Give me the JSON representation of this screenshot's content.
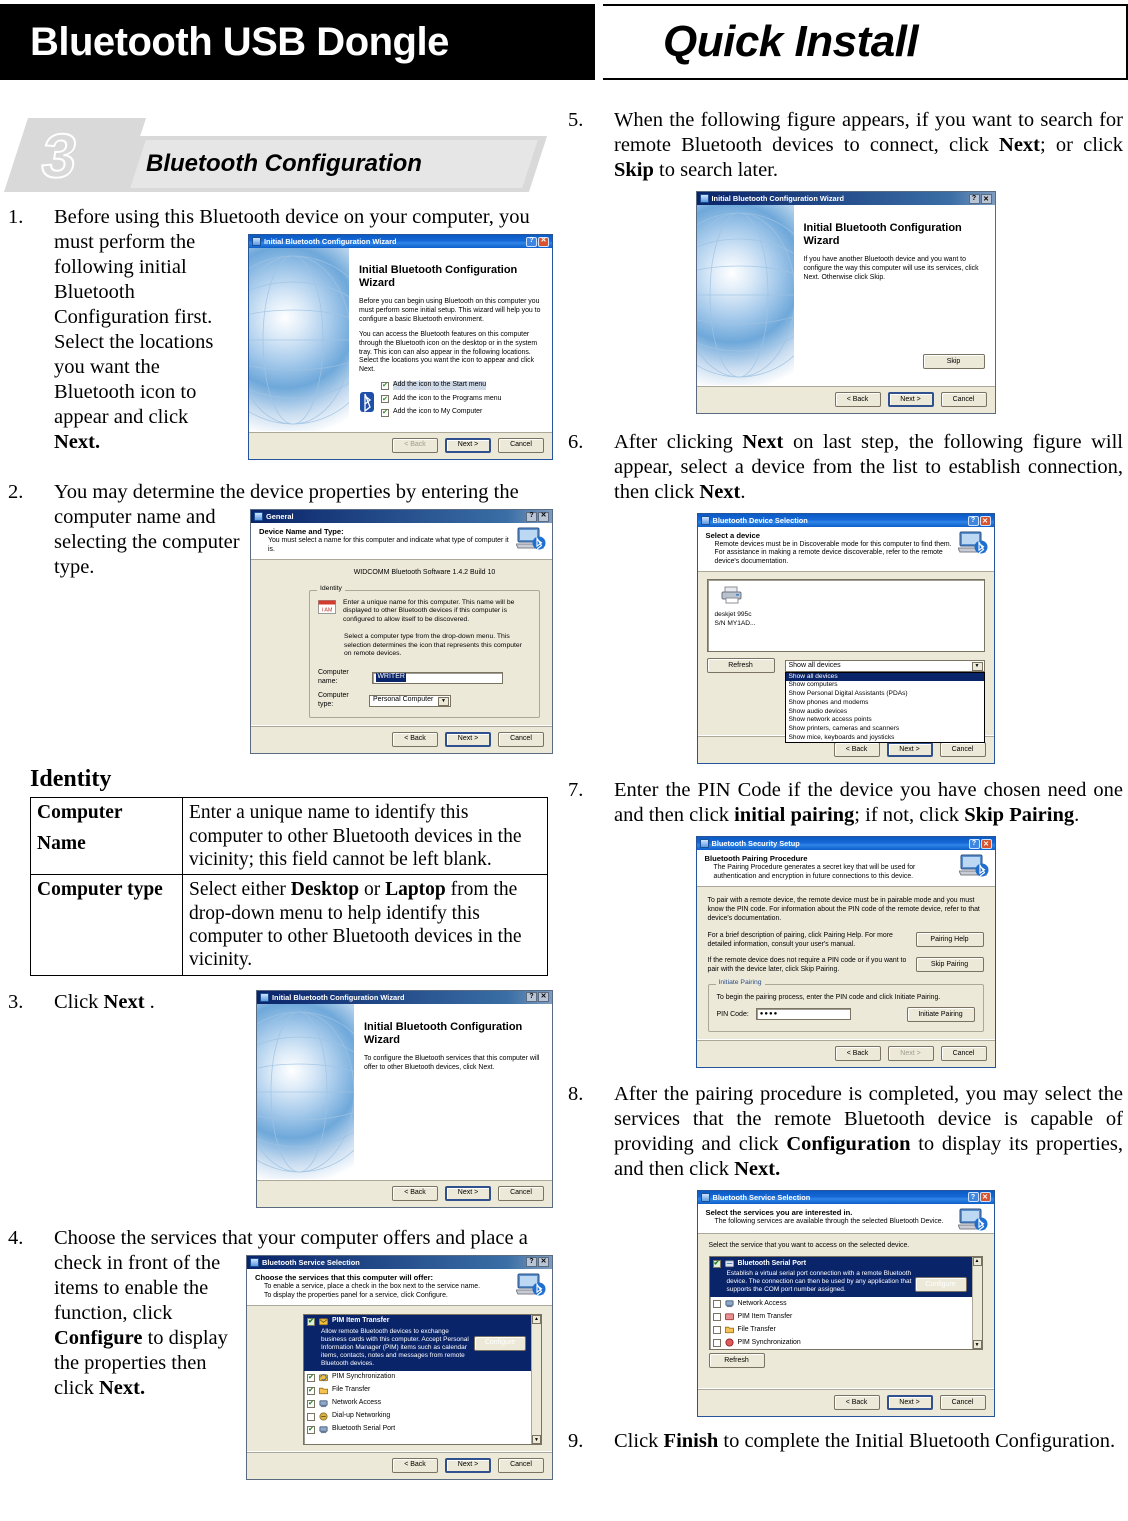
{
  "header": {
    "product_title": "Bluetooth USB Dongle",
    "doc_title": "Quick Install"
  },
  "section": {
    "number": "3",
    "title": "Bluetooth Configuration"
  },
  "identity_table": {
    "title": "Identity",
    "rows": [
      {
        "key": "Computer",
        "key2": "Name",
        "value_parts": [
          {
            "t": "Enter a unique name to identify this computer to other Bluetooth devices in the vicinity; this field cannot be left blank.",
            "b": false
          }
        ]
      },
      {
        "key": "Computer type",
        "key2": "",
        "value_parts": [
          {
            "t": "Select either ",
            "b": false
          },
          {
            "t": "Desktop",
            "b": true
          },
          {
            "t": " or ",
            "b": false
          },
          {
            "t": "Laptop",
            "b": true
          },
          {
            "t": " from the drop-down menu to help identify this computer to other Bluetooth devices in the vicinity.",
            "b": false
          }
        ]
      }
    ]
  },
  "steps": {
    "s1": {
      "num": "1.",
      "lead": "Before using this Bluetooth device on your computer, you",
      "rest_a": "must perform the following initial Bluetooth Configuration first. Select the locations you want the Bluetooth icon to appear and click ",
      "rest_b": "Next."
    },
    "s2": {
      "num": "2.",
      "lead": "You may determine the device properties by entering the",
      "rest": "computer name and selecting the computer type."
    },
    "s3": {
      "num": "3.",
      "a": "Click ",
      "b": "Next",
      "c": " ."
    },
    "s4": {
      "num": "4.",
      "lead": "Choose the services that your computer offers and place a",
      "a": "check in front of the items to enable the function, click ",
      "b": "Configure",
      "c": " to display the properties then click ",
      "d": "Next."
    },
    "s5": {
      "num": "5.",
      "a": "When the following figure appears, if you want to search for remote Bluetooth devices to connect, click ",
      "b": "Next",
      "c": "; or click ",
      "d": "Skip",
      "e": " to search later."
    },
    "s6": {
      "num": "6.",
      "a": "After clicking ",
      "b": "Next",
      "c": " on last step, the following figure will appear, select a device from the list to establish connection, then click ",
      "d": "Next",
      "e": "."
    },
    "s7": {
      "num": "7.",
      "a": "Enter the PIN Code if the device you have chosen need one and then click ",
      "b": "initial pairing",
      "c": "; if not, click ",
      "d": "Skip Pairing",
      "e": "."
    },
    "s8": {
      "num": "8.",
      "a": "After the pairing procedure is completed, you may select the services that the remote Bluetooth device is capable of providing and click ",
      "b": "Configuration",
      "c": " to display its properties, and then click ",
      "d": "Next."
    },
    "s9": {
      "num": "9.",
      "a": "Click ",
      "b": "Finish",
      "c": " to complete the Initial Bluetooth Configuration."
    }
  },
  "dialogs": {
    "wizard1": {
      "title": "Initial Bluetooth Configuration Wizard",
      "heading": "Initial Bluetooth Configuration Wizard",
      "p1": "Before you can begin using Bluetooth on this computer you must perform some initial setup. This wizard will help you to configure a basic Bluetooth environment.",
      "p2": "You can access the Bluetooth features on this computer through the Bluetooth icon on the desktop or in the system tray. This icon can also appear in the following locations. Select the locations you want the icon to appear and click Next.",
      "checks": [
        "Add the icon to the Start menu",
        "Add the icon to the Programs menu",
        "Add the icon to My Computer"
      ],
      "buttons": {
        "back": "< Back",
        "next": "Next >",
        "cancel": "Cancel"
      }
    },
    "general": {
      "title": "General",
      "hdr_title": "Device Name and Type:",
      "hdr_sub": "You must select a name for this computer and indicate what type of computer it is.",
      "version": "WIDCOMM Bluetooth Software 1.4.2 Build 10",
      "group_label": "Identity",
      "p1": "Enter a unique name for this computer.  This name will be displayed to other Bluetooth devices if this computer is configured to allow itself to be discovered.",
      "p2": "Select a computer type from the drop-down menu.  This selection determines the icon that represents this computer on remote devices.",
      "name_label": "Computer name:",
      "name_value": "WRITER",
      "type_label": "Computer type:",
      "type_value": "Personal Computer",
      "buttons": {
        "back": "< Back",
        "next": "Next >",
        "cancel": "Cancel"
      }
    },
    "wizard2": {
      "title": "Initial Bluetooth Configuration Wizard",
      "heading": "Initial Bluetooth Configuration Wizard",
      "p1": "To configure the Bluetooth services that this computer will offer to other Bluetooth devices, click Next.",
      "buttons": {
        "back": "< Back",
        "next": "Next >",
        "cancel": "Cancel"
      }
    },
    "wizard3": {
      "title": "Initial Bluetooth Configuration Wizard",
      "heading": "Initial Bluetooth Configuration Wizard",
      "p1": "If you have another Bluetooth device and you want to configure the way this computer will use its services, click Next. Otherwise click Skip.",
      "skip": "Skip",
      "buttons": {
        "back": "< Back",
        "next": "Next >",
        "cancel": "Cancel"
      }
    },
    "svc_offer": {
      "title": "Bluetooth Service Selection",
      "hdr_title": "Choose the services that this computer will offer:",
      "hdr_sub1": "To enable a service, place a check in the box next to the service name.",
      "hdr_sub2": "To display the properties panel for a service, click Configure.",
      "sel_name": "PIM Item Transfer",
      "sel_desc": "Allow remote Bluetooth devices to exchange business cards with this computer. Accept Personal Information Manager (PIM) items such as calendar items, contacts, notes and messages from remote Bluetooth devices.",
      "configure": "Configure",
      "items": [
        {
          "label": "PIM Synchronization",
          "checked": true
        },
        {
          "label": "File Transfer",
          "checked": true
        },
        {
          "label": "Network Access",
          "checked": true
        },
        {
          "label": "Dial-up Networking",
          "checked": false
        },
        {
          "label": "Bluetooth Serial Port",
          "checked": true
        }
      ],
      "buttons": {
        "back": "< Back",
        "next": "Next >",
        "cancel": "Cancel"
      }
    },
    "dev_select": {
      "title": "Bluetooth Device Selection",
      "hdr_title": "Select a device",
      "hdr_sub": "Remote devices must be in Discoverable mode for this computer to find them. For assistance in making a remote device discoverable, refer to the remote device's documentation.",
      "device_name": "deskjet 995c",
      "device_sn": "S/N MY1AD...",
      "refresh": "Refresh",
      "filter_value": "Show all devices",
      "filter_options": [
        "Show all devices",
        "Show computers",
        "Show Personal Digital Assistants (PDAs)",
        "Show phones and modems",
        "Show audio devices",
        "Show network access points",
        "Show printers, cameras and scanners",
        "Show mice, keyboards and joysticks"
      ],
      "buttons": {
        "back": "< Back",
        "next": "Next >",
        "cancel": "Cancel"
      }
    },
    "security": {
      "title": "Bluetooth Security Setup",
      "hdr_title": "Bluetooth Pairing Procedure",
      "hdr_sub": "The Pairing Procedure generates a secret key that will be used for authentication and encryption in future connections to this device.",
      "p1": "To pair with a remote device, the remote device must be in pairable mode and you must know the PIN code.  For information about the PIN code of the remote device, refer to that device's documentation.",
      "p2": "For a brief description of pairing, click Pairing Help.  For more detailed information, consult your user's manual.",
      "btn_help": "Pairing Help",
      "p3": "If the remote device does not require a PIN code or if you want to pair with the device later, click Skip Pairing.",
      "btn_skip": "Skip Pairing",
      "group_label": "Initiate Pairing",
      "p4": "To begin the pairing process, enter the PIN code and click Initiate Pairing.",
      "pin_label": "PIN Code:",
      "pin_value": "●●●●",
      "btn_initiate": "Initiate Pairing",
      "buttons": {
        "back": "< Back",
        "next": "Next >",
        "cancel": "Cancel"
      }
    },
    "svc_interest": {
      "title": "Bluetooth Service Selection",
      "hdr_title": "Select the services you are interested in.",
      "hdr_sub": "The following services are available through the selected Bluetooth Device.",
      "intro": "Select the service that you want to access on the selected device.",
      "sel_name": "Bluetooth Serial Port",
      "sel_desc": "Establish a virtual serial port connection with a remote Bluetooth device. The connection can then be used by any application that supports the COM port number assigned.",
      "configure": "Configure",
      "items": [
        {
          "label": "Network Access",
          "checked": false
        },
        {
          "label": "PIM Item Transfer",
          "checked": false
        },
        {
          "label": "File Transfer",
          "checked": false
        },
        {
          "label": "PIM Synchronization",
          "checked": false
        }
      ],
      "refresh": "Refresh",
      "buttons": {
        "back": "< Back",
        "next": "Next >",
        "cancel": "Cancel"
      }
    }
  },
  "colors": {
    "banner_bg": "#000000",
    "badge_grey": "#d9d9d9",
    "xp_face": "#ece9d8",
    "xp_title": "#0a5bc4",
    "xp_select": "#0a246a"
  }
}
